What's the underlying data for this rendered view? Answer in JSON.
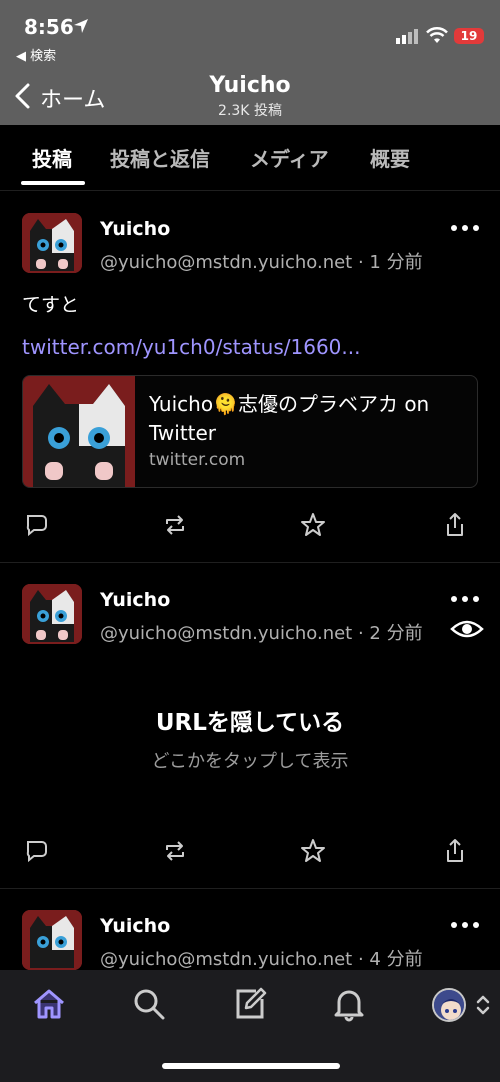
{
  "status_bar": {
    "time": "8:56",
    "back_app": "◀ 検索",
    "battery": "19"
  },
  "nav": {
    "back_label": "ホーム",
    "title": "Yuicho",
    "subtitle": "2.3K 投稿"
  },
  "tabs": [
    {
      "label": "投稿",
      "active": true
    },
    {
      "label": "投稿と返信",
      "active": false
    },
    {
      "label": "メディア",
      "active": false
    },
    {
      "label": "概要",
      "active": false
    }
  ],
  "posts": [
    {
      "author": "Yuicho",
      "handle": "@yuicho@mstdn.yuicho.net · 1 分前",
      "text": "てすと",
      "link": "twitter.com/yu1ch0/status/1660...",
      "card": {
        "title": "Yuicho🫠志優のプラベアカ on Twitter",
        "host": "twitter.com"
      }
    },
    {
      "author": "Yuicho",
      "handle": "@yuicho@mstdn.yuicho.net · 2 分前",
      "hidden_title": "URLを隠している",
      "hidden_sub": "どこかをタップして表示"
    },
    {
      "author": "Yuicho",
      "handle": "@yuicho@mstdn.yuicho.net · 4 分前"
    }
  ],
  "colors": {
    "accent": "#9f95ff",
    "header_bg": "#5f5f5f",
    "background": "#000000"
  },
  "icons": {
    "actions": [
      "reply-icon",
      "boost-icon",
      "favourite-icon",
      "share-icon"
    ],
    "tabbar": [
      "home-icon",
      "search-icon",
      "compose-icon",
      "notifications-icon",
      "account-avatar"
    ]
  }
}
